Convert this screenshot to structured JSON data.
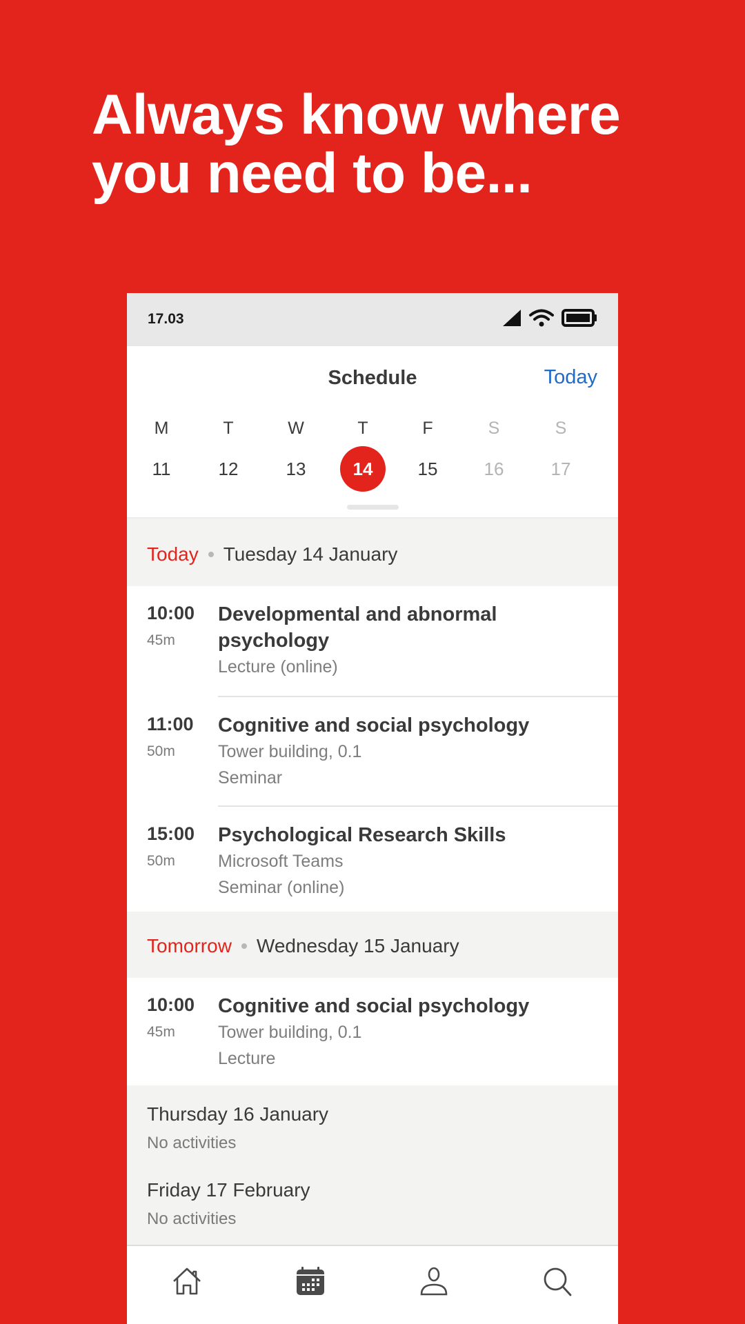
{
  "promo": {
    "headline_line1": "Always know where",
    "headline_line2": "you need to be..."
  },
  "statusbar": {
    "time": "17.03",
    "icons": [
      "cell-signal-icon",
      "wifi-icon",
      "battery-icon"
    ]
  },
  "header": {
    "title": "Schedule",
    "today_link": "Today"
  },
  "week": {
    "days": [
      {
        "letter": "M",
        "num": "11",
        "weekend": false,
        "selected": false
      },
      {
        "letter": "T",
        "num": "12",
        "weekend": false,
        "selected": false
      },
      {
        "letter": "W",
        "num": "13",
        "weekend": false,
        "selected": false
      },
      {
        "letter": "T",
        "num": "14",
        "weekend": false,
        "selected": true
      },
      {
        "letter": "F",
        "num": "15",
        "weekend": false,
        "selected": false
      },
      {
        "letter": "S",
        "num": "16",
        "weekend": true,
        "selected": false
      },
      {
        "letter": "S",
        "num": "17",
        "weekend": true,
        "selected": false
      }
    ]
  },
  "agenda": {
    "today": {
      "relative": "Today",
      "date": "Tuesday 14 January",
      "events": [
        {
          "time": "10:00",
          "duration": "45m",
          "title": "Developmental and abnormal psychology",
          "lines": [
            "Lecture (online)"
          ]
        },
        {
          "time": "11:00",
          "duration": "50m",
          "title": "Cognitive and social psychology",
          "lines": [
            "Tower building, 0.1",
            "Seminar"
          ]
        },
        {
          "time": "15:00",
          "duration": "50m",
          "title": "Psychological Research Skills",
          "lines": [
            "Microsoft Teams",
            "Seminar (online)"
          ]
        }
      ]
    },
    "tomorrow": {
      "relative": "Tomorrow",
      "date": "Wednesday 15 January",
      "events": [
        {
          "time": "10:00",
          "duration": "45m",
          "title": "Cognitive and social psychology",
          "lines": [
            "Tower building, 0.1",
            "Lecture"
          ]
        }
      ]
    },
    "empty_days": [
      {
        "date": "Thursday 16 January",
        "note": "No activities"
      },
      {
        "date": "Friday 17 February",
        "note": "No activities"
      }
    ]
  },
  "bottom_nav": {
    "items": [
      {
        "name": "home",
        "icon": "home-icon",
        "active": false
      },
      {
        "name": "schedule",
        "icon": "calendar-icon",
        "active": true
      },
      {
        "name": "profile",
        "icon": "person-icon",
        "active": false
      },
      {
        "name": "search",
        "icon": "search-icon",
        "active": false
      }
    ]
  },
  "colors": {
    "brand_red": "#e3241c",
    "link_blue": "#1f6bc9",
    "text_dark": "#3a3a3a",
    "text_muted": "#7d7d7d",
    "band_gray": "#f3f3f1"
  }
}
